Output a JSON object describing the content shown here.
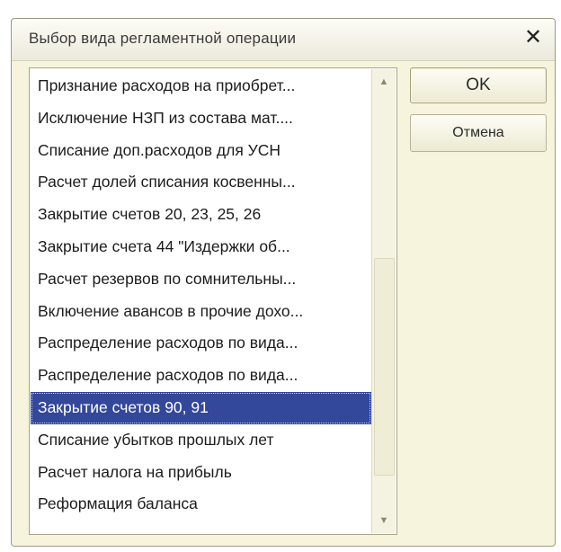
{
  "dialog": {
    "title": "Выбор вида регламентной операции",
    "close_symbol": "✕"
  },
  "list": {
    "items": [
      "Признание расходов на приобрет...",
      "Исключение НЗП из состава мат....",
      "Списание доп.расходов для УСН",
      "Расчет долей списания косвенны...",
      "Закрытие счетов 20, 23, 25, 26",
      "Закрытие счета 44 \"Издержки об...",
      "Расчет резервов по сомнительны...",
      "Включение авансов в прочие дохо...",
      "Распределение расходов по вида...",
      "Распределение расходов по вида...",
      "Закрытие счетов 90, 91",
      "Списание убытков прошлых лет",
      "Расчет налога на прибыль",
      "Реформация баланса"
    ],
    "selected_index": 10
  },
  "scrollbar": {
    "up_icon": "▲",
    "down_icon": "▼"
  },
  "buttons": {
    "ok_label": "OK",
    "cancel_label": "Отмена"
  },
  "colors": {
    "selection": "#33479b",
    "dialog_background": "#f6f4dc"
  }
}
